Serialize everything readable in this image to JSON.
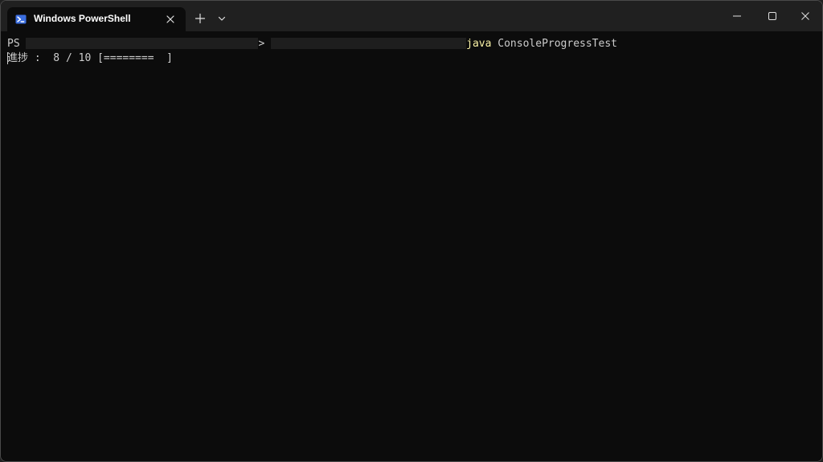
{
  "window": {
    "tab_title": "Windows PowerShell",
    "tab_icon": "powershell-icon",
    "new_tab_icon": "plus-icon",
    "dropdown_icon": "chevron-down-icon",
    "controls": [
      "minimize-icon",
      "maximize-icon",
      "close-icon"
    ]
  },
  "terminal": {
    "prompt_prefix": "PS",
    "prompt_separator": ">",
    "command": "java",
    "command_args": "ConsoleProgressTest",
    "progress_line": "進捗 :  8 / 10 [========  ]",
    "progress": {
      "current": 8,
      "total": 10
    }
  },
  "colors": {
    "background": "#0c0c0c",
    "titlebar": "#202020",
    "text": "#cccccc",
    "command": "#f9f1a5"
  }
}
